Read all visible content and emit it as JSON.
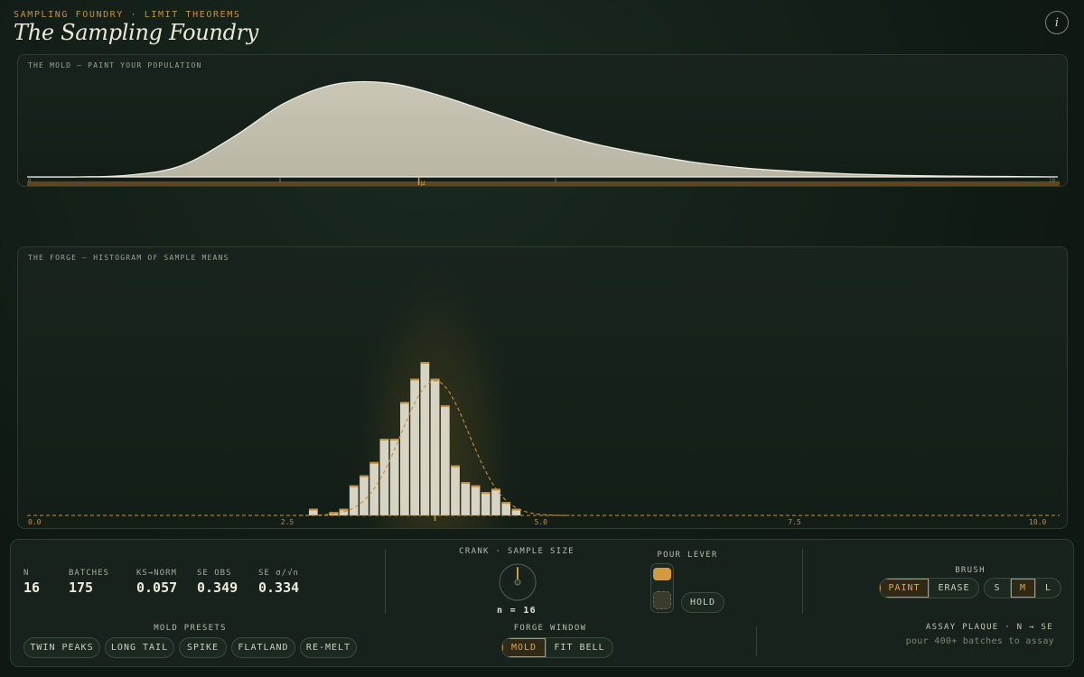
{
  "header": {
    "kicker": "SAMPLING FOUNDRY · LIMIT THEOREMS",
    "title": "The Sampling Foundry",
    "info_icon_glyph": "i"
  },
  "mold": {
    "label": "THE MOLD — PAINT YOUR POPULATION",
    "axis_min_label": "0",
    "axis_max_label": "10",
    "mu_label": "μ",
    "colors": {
      "fill": "#c9c6b5",
      "rail": "#5e4720",
      "accent": "#d39a42"
    }
  },
  "forge": {
    "label": "THE FORGE — HISTOGRAM OF SAMPLE MEANS",
    "colors": {
      "bar": "#d8d4c4",
      "bar_cap": "#c8903a",
      "curve": "#c8903a"
    }
  },
  "chart_data": [
    {
      "type": "area",
      "title": "THE MOLD — PAINT YOUR POPULATION",
      "xlim": [
        0,
        10
      ],
      "description_values": "population density painted on the mold",
      "x": [
        0,
        0.5,
        1.0,
        1.5,
        2.0,
        2.5,
        3.0,
        3.5,
        4.0,
        4.5,
        5.0,
        5.5,
        6.0,
        6.5,
        7.0,
        7.5,
        8.0,
        8.5,
        9.0,
        9.5,
        10.0
      ],
      "y": [
        0.0,
        0.0,
        0.02,
        0.12,
        0.42,
        0.78,
        0.98,
        0.99,
        0.86,
        0.68,
        0.5,
        0.35,
        0.24,
        0.15,
        0.09,
        0.055,
        0.03,
        0.015,
        0.008,
        0.004,
        0.0
      ],
      "mu": 3.8,
      "axis_ticks": [
        "0",
        "10"
      ]
    },
    {
      "type": "bar",
      "title": "THE FORGE — HISTOGRAM OF SAMPLE MEANS",
      "xlim": [
        0,
        10
      ],
      "x_ticks": [
        "0.0",
        "2.5",
        "5.0",
        "7.5",
        "10.0"
      ],
      "bin_width": 0.1,
      "bins": [
        2.75,
        2.85,
        2.95,
        3.05,
        3.15,
        3.25,
        3.35,
        3.45,
        3.55,
        3.65,
        3.75,
        3.85,
        3.95,
        4.05,
        4.15,
        4.25,
        4.35,
        4.45,
        4.55,
        4.65,
        4.75,
        4.85,
        4.95
      ],
      "counts": [
        2,
        0,
        1,
        2,
        9,
        12,
        16,
        23,
        23,
        34,
        41,
        46,
        41,
        33,
        15,
        10,
        9,
        7,
        8,
        4,
        2,
        0,
        0
      ],
      "fit_bell": {
        "mean": 3.95,
        "se": 0.334
      },
      "marker_x": 3.95
    }
  ],
  "stats": [
    {
      "label": "N",
      "value": "16"
    },
    {
      "label": "BATCHES",
      "value": "175"
    },
    {
      "label": "KS→NORM",
      "value": "0.057"
    },
    {
      "label": "SE OBS",
      "value": "0.349"
    },
    {
      "label": "SE σ/√n",
      "value": "0.334"
    }
  ],
  "presets": {
    "label": "MOLD PRESETS",
    "items": [
      "TWIN PEAKS",
      "LONG TAIL",
      "SPIKE",
      "FLATLAND",
      "RE-MELT"
    ]
  },
  "crank": {
    "label": "CRANK · SAMPLE SIZE",
    "value_text": "n = 16"
  },
  "forge_window": {
    "label": "FORGE WINDOW",
    "options": [
      "MOLD",
      "FIT BELL"
    ],
    "selected": "MOLD"
  },
  "pour": {
    "label": "POUR LEVER",
    "hold_label": "HOLD"
  },
  "brush": {
    "label": "BRUSH",
    "modes": [
      "PAINT",
      "ERASE"
    ],
    "selected_mode": "PAINT",
    "sizes": [
      "S",
      "M",
      "L"
    ],
    "selected_size": "M"
  },
  "assay": {
    "title": "ASSAY PLAQUE · N → SE",
    "note": "pour 400+ batches to assay"
  }
}
